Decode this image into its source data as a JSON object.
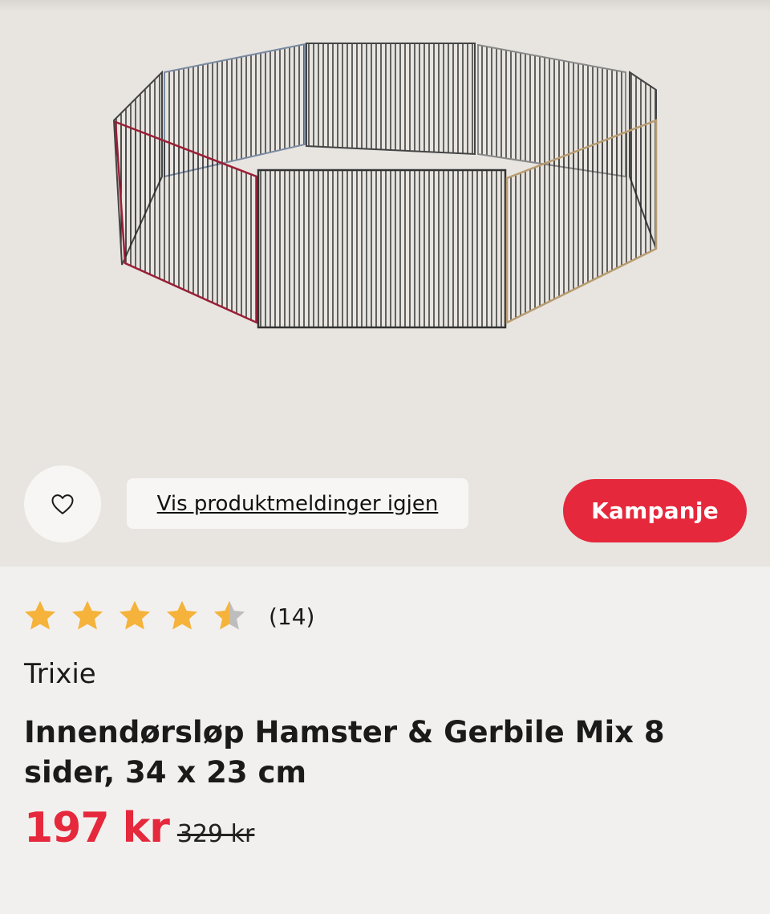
{
  "product_image": {
    "alt": "Innendørsløp Hamster & Gerbile Mix 8 sider"
  },
  "actions": {
    "favorite_icon": "heart-outline-icon",
    "show_notifications_label": "Vis produktmeldinger igjen",
    "campaign_badge": "Kampanje"
  },
  "colors": {
    "accent": "#e5283c",
    "star": "#f5b33b",
    "star_empty": "#bdbdbd",
    "hero_bg": "#e8e5e1",
    "page_bg": "#f2f0ee"
  },
  "rating": {
    "value": 4.5,
    "max": 5,
    "count_label": "(14)"
  },
  "product": {
    "brand": "Trixie",
    "title": "Innendørsløp Hamster & Gerbile Mix 8 sider, 34 x 23 cm",
    "price_current": "197 kr",
    "price_original": "329 kr"
  }
}
